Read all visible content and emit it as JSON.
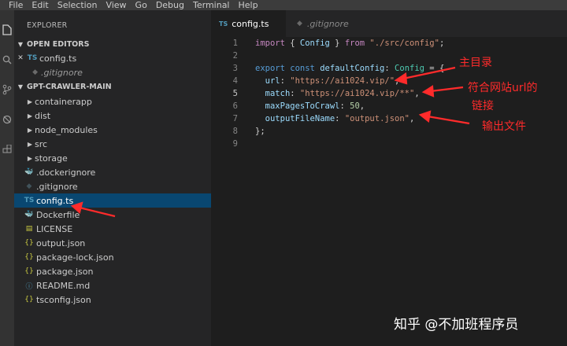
{
  "menu": [
    "File",
    "Edit",
    "Selection",
    "View",
    "Go",
    "Debug",
    "Terminal",
    "Help"
  ],
  "sidebar": {
    "title": "EXPLORER",
    "open_editors_label": "OPEN EDITORS",
    "open_editors": [
      {
        "icon": "TS",
        "close": "✕",
        "name": "config.ts"
      },
      {
        "name": ".gitignore"
      }
    ],
    "project_label": "GPT-CRAWLER-MAIN",
    "folders": [
      "containerapp",
      "dist",
      "node_modules",
      "src",
      "storage"
    ],
    "files": [
      {
        "icon": "docker",
        "name": ".dockerignore"
      },
      {
        "icon": "git",
        "name": ".gitignore"
      },
      {
        "icon": "TS",
        "name": "config.ts",
        "selected": true
      },
      {
        "icon": "docker",
        "name": "Dockerfile"
      },
      {
        "icon": "license",
        "name": "LICENSE"
      },
      {
        "icon": "json",
        "name": "output.json"
      },
      {
        "icon": "json",
        "name": "package-lock.json"
      },
      {
        "icon": "json",
        "name": "package.json"
      },
      {
        "icon": "info",
        "name": "README.md"
      },
      {
        "icon": "json",
        "name": "tsconfig.json"
      }
    ]
  },
  "tabs": [
    {
      "icon": "TS",
      "label": "config.ts",
      "active": true
    },
    {
      "label": ".gitignore",
      "active": false
    }
  ],
  "code": {
    "line_numbers": [
      "1",
      "2",
      "3",
      "4",
      "5",
      "6",
      "7",
      "8",
      "9"
    ],
    "l1": {
      "import": "import",
      "brace1": " { ",
      "Config": "Config",
      "brace2": " } ",
      "from": "from ",
      "path": "\"./src/config\"",
      "semi": ";"
    },
    "l3": {
      "export": "export ",
      "const": "const ",
      "name": "defaultConfig",
      "colon": ": ",
      "type": "Config",
      "eq": " = {"
    },
    "l4": {
      "key": "url",
      "colon": ": ",
      "val": "\"https://ai1024.vip/\"",
      "comma": ","
    },
    "l5": {
      "key": "match",
      "colon": ": ",
      "val": "\"https://ai1024.vip/**\"",
      "comma": ","
    },
    "l6": {
      "key": "maxPagesToCrawl",
      "colon": ": ",
      "val": "50",
      "comma": ","
    },
    "l7": {
      "key": "outputFileName",
      "colon": ": ",
      "val": "\"output.json\"",
      "comma": ","
    },
    "l8": "};"
  },
  "annotations": {
    "main_dir": "主目录",
    "url_match_1": "符合网站url的",
    "url_match_2": "链接",
    "output_file": "输出文件"
  },
  "watermark": "知乎 @不加班程序员",
  "colors": {
    "annotation": "#ff2b2b",
    "selection": "#094771",
    "ts_icon": "#519aba",
    "json_icon": "#cbcb41"
  }
}
